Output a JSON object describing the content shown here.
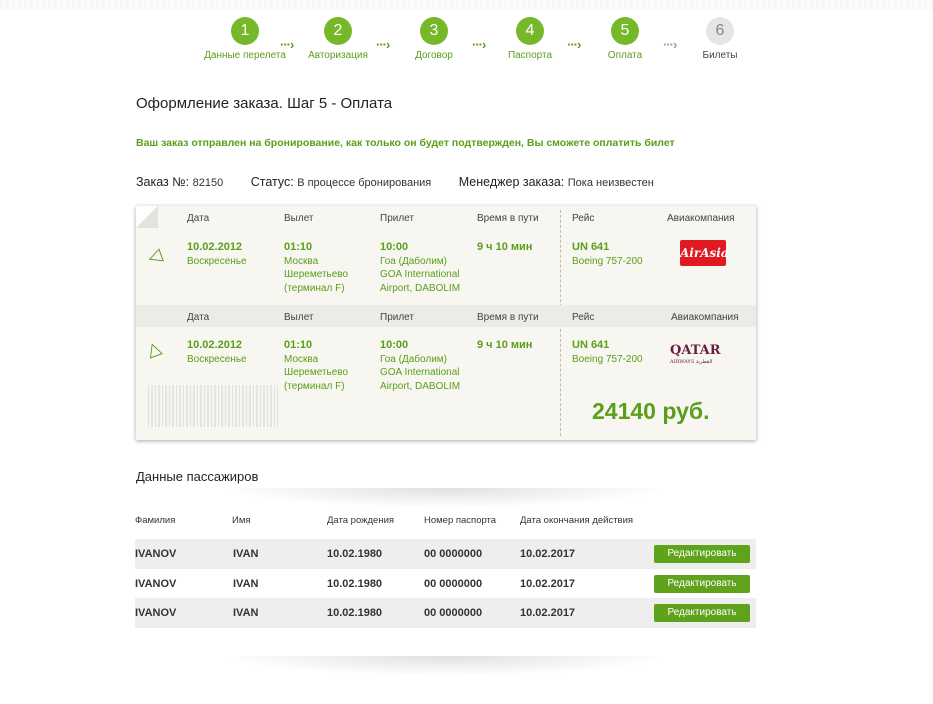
{
  "steps": [
    {
      "num": "1",
      "label": "Данные перелета",
      "active": true
    },
    {
      "num": "2",
      "label": "Авторизация",
      "active": true
    },
    {
      "num": "3",
      "label": "Договор",
      "active": true
    },
    {
      "num": "4",
      "label": "Паспорта",
      "active": true
    },
    {
      "num": "5",
      "label": "Оплата",
      "active": true
    },
    {
      "num": "6",
      "label": "Билеты",
      "active": false
    }
  ],
  "arrow_glyph": "···›",
  "page_title": "Оформление заказа. Шаг 5 - Оплата",
  "notice": "Ваш заказ отправлен на бронирование, как только он будет подтвержден, Вы сможете оплатить билет",
  "order": {
    "number_label": "Заказ №:",
    "number": "82150",
    "status_label": "Статус:",
    "status": "В процессе бронирования",
    "manager_label": "Менеджер заказа:",
    "manager": "Пока неизвестен"
  },
  "flight_headers": {
    "date": "Дата",
    "departure": "Вылет",
    "arrival": "Прилет",
    "duration": "Время в пути",
    "flight": "Рейс",
    "airline": "Авиакомпания"
  },
  "segments": [
    {
      "date": "10.02.2012",
      "weekday": "Воскресенье",
      "dep_time": "01:10",
      "dep_city": "Москва",
      "dep_airport": "Шереметьево",
      "dep_terminal": "(терминал F)",
      "arr_time": "10:00",
      "arr_city": "Гоа (Даболим)",
      "arr_airport1": "GOA International",
      "arr_airport2": "Airport, DABOLIM",
      "duration": "9 ч 10 мин",
      "flight_no": "UN 641",
      "aircraft": "Boeing 757-200",
      "airline_logo": "AirAsia"
    },
    {
      "date": "10.02.2012",
      "weekday": "Воскресенье",
      "dep_time": "01:10",
      "dep_city": "Москва",
      "dep_airport": "Шереметьево",
      "dep_terminal": "(терминал F)",
      "arr_time": "10:00",
      "arr_city": "Гоа (Даболим)",
      "arr_airport1": "GOA International",
      "arr_airport2": "Airport, DABOLIM",
      "duration": "9 ч 10 мин",
      "flight_no": "UN 641",
      "aircraft": "Boeing 757-200",
      "airline_logo": "QATAR",
      "airline_logo_sub": "AIRWAYS القطرية"
    }
  ],
  "price": "24140 руб.",
  "passengers": {
    "title": "Данные пассажиров",
    "headers": {
      "surname": "Фамилия",
      "name": "Имя",
      "birth": "Дата рождения",
      "passport": "Номер паспорта",
      "expiry": "Дата окончания действия"
    },
    "rows": [
      {
        "surname": "IVANOV",
        "name": "IVAN",
        "birth": "10.02.1980",
        "passport": "00 0000000",
        "expiry": "10.02.2017",
        "edit": "Редактировать"
      },
      {
        "surname": "IVANOV",
        "name": "IVAN",
        "birth": "10.02.1980",
        "passport": "00 0000000",
        "expiry": "10.02.2017",
        "edit": "Редактировать"
      },
      {
        "surname": "IVANOV",
        "name": "IVAN",
        "birth": "10.02.1980",
        "passport": "00 0000000",
        "expiry": "10.02.2017",
        "edit": "Редактировать"
      }
    ]
  },
  "colors": {
    "accent": "#76b82a",
    "accent_text": "#5a9e1a",
    "inactive_step": "#e5e5e5",
    "card_bg": "#f7f6f1",
    "airasia_red": "#e01a22",
    "qatar_maroon": "#6b1d3e"
  },
  "icons": {
    "plane_out": "plane-departure-icon",
    "plane_back": "plane-return-icon"
  }
}
